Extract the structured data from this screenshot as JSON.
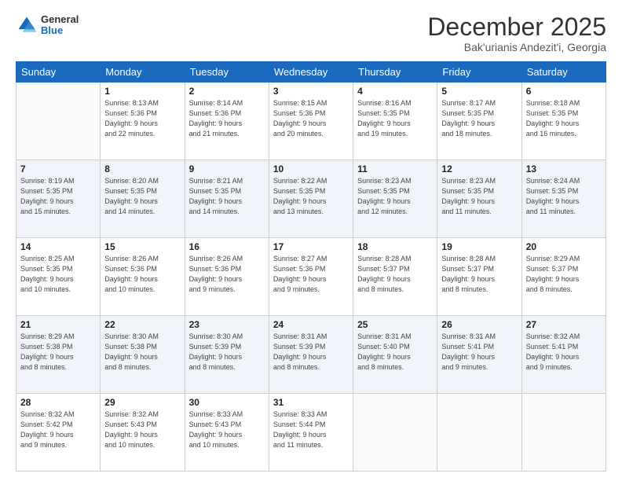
{
  "header": {
    "logo": {
      "general": "General",
      "blue": "Blue"
    },
    "title": "December 2025",
    "subtitle": "Bak'urianis Andezit'i, Georgia"
  },
  "days_of_week": [
    "Sunday",
    "Monday",
    "Tuesday",
    "Wednesday",
    "Thursday",
    "Friday",
    "Saturday"
  ],
  "weeks": [
    [
      {
        "day": "",
        "info": ""
      },
      {
        "day": "1",
        "info": "Sunrise: 8:13 AM\nSunset: 5:36 PM\nDaylight: 9 hours\nand 22 minutes."
      },
      {
        "day": "2",
        "info": "Sunrise: 8:14 AM\nSunset: 5:36 PM\nDaylight: 9 hours\nand 21 minutes."
      },
      {
        "day": "3",
        "info": "Sunrise: 8:15 AM\nSunset: 5:36 PM\nDaylight: 9 hours\nand 20 minutes."
      },
      {
        "day": "4",
        "info": "Sunrise: 8:16 AM\nSunset: 5:35 PM\nDaylight: 9 hours\nand 19 minutes."
      },
      {
        "day": "5",
        "info": "Sunrise: 8:17 AM\nSunset: 5:35 PM\nDaylight: 9 hours\nand 18 minutes."
      },
      {
        "day": "6",
        "info": "Sunrise: 8:18 AM\nSunset: 5:35 PM\nDaylight: 9 hours\nand 16 minutes."
      }
    ],
    [
      {
        "day": "7",
        "info": "Sunrise: 8:19 AM\nSunset: 5:35 PM\nDaylight: 9 hours\nand 15 minutes."
      },
      {
        "day": "8",
        "info": "Sunrise: 8:20 AM\nSunset: 5:35 PM\nDaylight: 9 hours\nand 14 minutes."
      },
      {
        "day": "9",
        "info": "Sunrise: 8:21 AM\nSunset: 5:35 PM\nDaylight: 9 hours\nand 14 minutes."
      },
      {
        "day": "10",
        "info": "Sunrise: 8:22 AM\nSunset: 5:35 PM\nDaylight: 9 hours\nand 13 minutes."
      },
      {
        "day": "11",
        "info": "Sunrise: 8:23 AM\nSunset: 5:35 PM\nDaylight: 9 hours\nand 12 minutes."
      },
      {
        "day": "12",
        "info": "Sunrise: 8:23 AM\nSunset: 5:35 PM\nDaylight: 9 hours\nand 11 minutes."
      },
      {
        "day": "13",
        "info": "Sunrise: 8:24 AM\nSunset: 5:35 PM\nDaylight: 9 hours\nand 11 minutes."
      }
    ],
    [
      {
        "day": "14",
        "info": "Sunrise: 8:25 AM\nSunset: 5:35 PM\nDaylight: 9 hours\nand 10 minutes."
      },
      {
        "day": "15",
        "info": "Sunrise: 8:26 AM\nSunset: 5:36 PM\nDaylight: 9 hours\nand 10 minutes."
      },
      {
        "day": "16",
        "info": "Sunrise: 8:26 AM\nSunset: 5:36 PM\nDaylight: 9 hours\nand 9 minutes."
      },
      {
        "day": "17",
        "info": "Sunrise: 8:27 AM\nSunset: 5:36 PM\nDaylight: 9 hours\nand 9 minutes."
      },
      {
        "day": "18",
        "info": "Sunrise: 8:28 AM\nSunset: 5:37 PM\nDaylight: 9 hours\nand 8 minutes."
      },
      {
        "day": "19",
        "info": "Sunrise: 8:28 AM\nSunset: 5:37 PM\nDaylight: 9 hours\nand 8 minutes."
      },
      {
        "day": "20",
        "info": "Sunrise: 8:29 AM\nSunset: 5:37 PM\nDaylight: 9 hours\nand 8 minutes."
      }
    ],
    [
      {
        "day": "21",
        "info": "Sunrise: 8:29 AM\nSunset: 5:38 PM\nDaylight: 9 hours\nand 8 minutes."
      },
      {
        "day": "22",
        "info": "Sunrise: 8:30 AM\nSunset: 5:38 PM\nDaylight: 9 hours\nand 8 minutes."
      },
      {
        "day": "23",
        "info": "Sunrise: 8:30 AM\nSunset: 5:39 PM\nDaylight: 9 hours\nand 8 minutes."
      },
      {
        "day": "24",
        "info": "Sunrise: 8:31 AM\nSunset: 5:39 PM\nDaylight: 9 hours\nand 8 minutes."
      },
      {
        "day": "25",
        "info": "Sunrise: 8:31 AM\nSunset: 5:40 PM\nDaylight: 9 hours\nand 8 minutes."
      },
      {
        "day": "26",
        "info": "Sunrise: 8:31 AM\nSunset: 5:41 PM\nDaylight: 9 hours\nand 9 minutes."
      },
      {
        "day": "27",
        "info": "Sunrise: 8:32 AM\nSunset: 5:41 PM\nDaylight: 9 hours\nand 9 minutes."
      }
    ],
    [
      {
        "day": "28",
        "info": "Sunrise: 8:32 AM\nSunset: 5:42 PM\nDaylight: 9 hours\nand 9 minutes."
      },
      {
        "day": "29",
        "info": "Sunrise: 8:32 AM\nSunset: 5:43 PM\nDaylight: 9 hours\nand 10 minutes."
      },
      {
        "day": "30",
        "info": "Sunrise: 8:33 AM\nSunset: 5:43 PM\nDaylight: 9 hours\nand 10 minutes."
      },
      {
        "day": "31",
        "info": "Sunrise: 8:33 AM\nSunset: 5:44 PM\nDaylight: 9 hours\nand 11 minutes."
      },
      {
        "day": "",
        "info": ""
      },
      {
        "day": "",
        "info": ""
      },
      {
        "day": "",
        "info": ""
      }
    ]
  ]
}
